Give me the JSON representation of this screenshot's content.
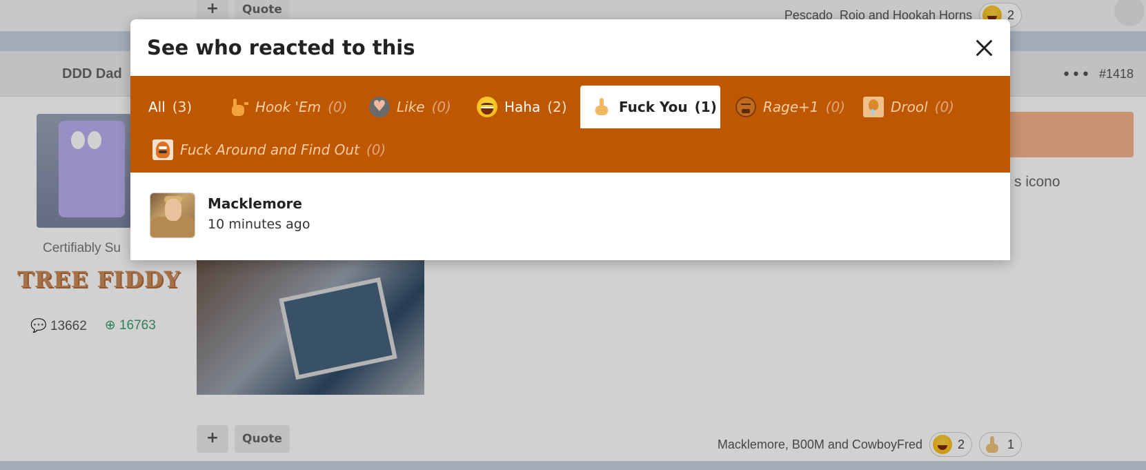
{
  "background": {
    "top_actions": {
      "plus_label": "+",
      "quote_label": "Quote"
    },
    "top_reactors_text": "Pescado_Rojo and Hookah Horns",
    "top_reaction_count": "2",
    "post_author": "DDD Dad",
    "post_menu_icon": "more-dots-icon",
    "post_menu_glyph": "•••",
    "post_number": "#1418",
    "user_title": "Certifiably Su",
    "user_banner": "TREE FIDDY",
    "stats": {
      "messages": "13662",
      "reaction_score": "16763"
    },
    "snippet_text": "s icono",
    "bottom_actions": {
      "plus_label": "+",
      "quote_label": "Quote"
    },
    "bottom_reactors_text": "Macklemore, B00M and CowboyFred",
    "bottom_reactions": [
      {
        "icon": "haha-emoji-icon",
        "count": "2"
      },
      {
        "icon": "middle-finger-icon",
        "count": "1"
      }
    ]
  },
  "modal": {
    "title": "See who reacted to this",
    "close_icon": "close-icon",
    "tabs": [
      {
        "label": "All",
        "count": "(3)",
        "icon": "",
        "has": true,
        "active": false
      },
      {
        "label": "Hook 'Em",
        "count": "(0)",
        "icon": "hook-em-horns-icon",
        "has": false,
        "active": false
      },
      {
        "label": "Like",
        "count": "(0)",
        "icon": "heart-like-icon",
        "has": false,
        "active": false
      },
      {
        "label": "Haha",
        "count": "(2)",
        "icon": "haha-emoji-icon",
        "has": true,
        "active": false
      },
      {
        "label": "Fuck You",
        "count": "(1)",
        "icon": "middle-finger-icon",
        "has": true,
        "active": true
      },
      {
        "label": "Rage+1",
        "count": "(0)",
        "icon": "rage-face-icon",
        "has": false,
        "active": false
      },
      {
        "label": "Drool",
        "count": "(0)",
        "icon": "drool-icon",
        "has": false,
        "active": false
      },
      {
        "label": "Fuck Around and Find Out",
        "count": "(0)",
        "icon": "gritty-mascot-icon",
        "has": false,
        "active": false
      }
    ],
    "reactions": [
      {
        "name": "Macklemore",
        "time": "10 minutes ago",
        "avatar": "user-avatar"
      }
    ]
  },
  "colors": {
    "accent": "#bd5700",
    "overlay": "rgba(0,0,0,0.18)",
    "link_green": "#3a9a6a"
  }
}
